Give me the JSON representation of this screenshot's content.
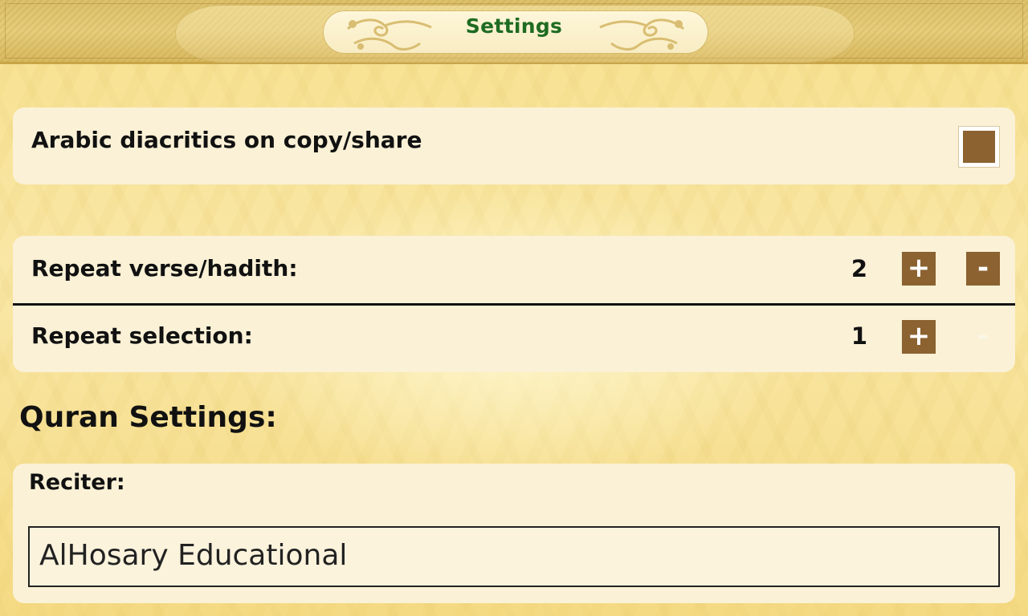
{
  "header": {
    "title": "Settings"
  },
  "general": {
    "diacritics_label": "Arabic diacritics on copy/share",
    "diacritics_checked": true,
    "repeat_verse_label": "Repeat verse/hadith:",
    "repeat_verse_value": "2",
    "repeat_selection_label": "Repeat selection:",
    "repeat_selection_value": "1",
    "plus_symbol": "+",
    "minus_symbol": "-",
    "repeat_selection_minus_enabled": false
  },
  "quran": {
    "heading": "Quran Settings:",
    "reciter_label": "Reciter:",
    "reciter_value": "AlHosary Educational"
  },
  "colors": {
    "title_green": "#1e6b22",
    "control_brown": "#8b6230",
    "card_background": "#faf1d6"
  },
  "icons": {
    "header_ornament": "arabesque-scroll-icon"
  }
}
